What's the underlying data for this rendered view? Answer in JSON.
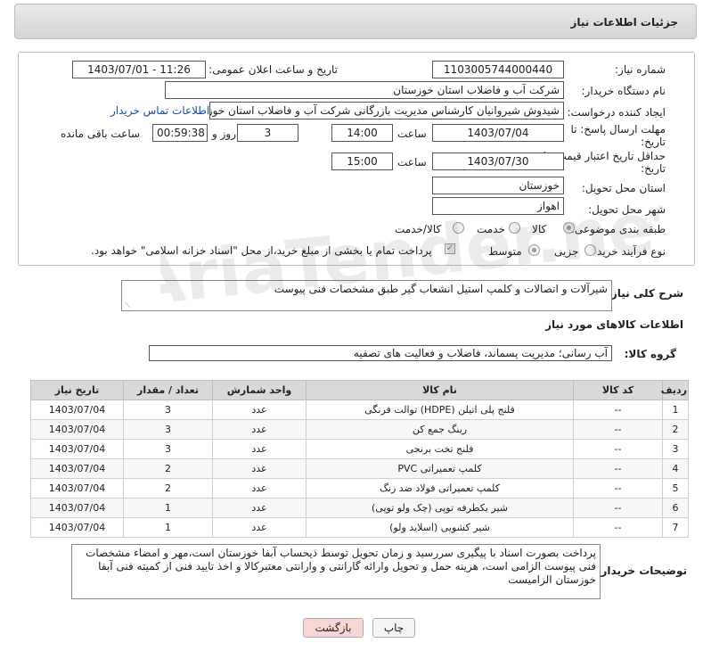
{
  "page": {
    "title": "جزئیات اطلاعات نیاز"
  },
  "form": {
    "need_number_label": "شماره نیاز:",
    "need_number": "1103005744000440",
    "announce_label": "تاریخ و ساعت اعلان عمومی:",
    "announce_value": "1403/07/01 - 11:26",
    "buyer_label": "نام دستگاه خریدار:",
    "buyer_value": "شرکت آب و فاضلاب استان خوزستان",
    "creator_label": "ایجاد کننده درخواست:",
    "creator_value": "شیدوش شیروانیان کارشناس مدیریت بازرگانی شرکت آب و فاضلاب استان خوزس",
    "contact_link": "اطلاعات تماس خریدار",
    "deadline_label": "مهلت ارسال پاسخ: تا",
    "deadline_label2": "تاریخ:",
    "deadline_date": "1403/07/04",
    "time_label": "ساعت",
    "deadline_time": "14:00",
    "days_value": "3",
    "days_label": "روز و",
    "remaining_value": "00:59:38",
    "remaining_label": "ساعت باقی مانده",
    "validity_label": "حداقل تاریخ اعتبار قیمت: تا",
    "validity_label2": "تاریخ:",
    "validity_date": "1403/07/30",
    "validity_time": "15:00",
    "province_label": "استان محل تحویل:",
    "province_value": "خوزستان",
    "city_label": "شهر محل تحویل:",
    "city_value": "اهواز",
    "category_label": "طبقه بندی موضوعی:",
    "category_options": [
      "کالا",
      "خدمت",
      "کالا/خدمت"
    ],
    "process_label": "نوع فرآیند خرید :",
    "process_options": [
      "جزیی",
      "متوسط"
    ],
    "payment_note": "پرداخت تمام یا بخشی از مبلغ خرید،از محل \"اسناد خزانه اسلامی\" خواهد بود."
  },
  "description": {
    "label": "شرح کلی نیاز:",
    "value": "شیرآلات و اتصالات و کلمپ استیل انشعاب گیر  طبق مشخصات فنی پیوست"
  },
  "goods": {
    "section_title": "اطلاعات کالاهای مورد نیاز",
    "group_label": "گروه کالا:",
    "group_value": "آب رسانی؛ مدیریت پسماند، فاضلاب و فعالیت های تصفیه",
    "columns": [
      "ردیف",
      "کد کالا",
      "نام کالا",
      "واحد شمارش",
      "تعداد / مقدار",
      "تاریخ نیاز"
    ],
    "rows": [
      [
        "1",
        "--",
        "فلنج پلی اتیلن (HDPE) توالت فرنگی",
        "عدد",
        "3",
        "1403/07/04"
      ],
      [
        "2",
        "--",
        "رینگ جمع کن",
        "عدد",
        "3",
        "1403/07/04"
      ],
      [
        "3",
        "--",
        "فلنج تخت برنجی",
        "عدد",
        "3",
        "1403/07/04"
      ],
      [
        "4",
        "--",
        "کلمپ تعمیراتی PVC",
        "عدد",
        "2",
        "1403/07/04"
      ],
      [
        "5",
        "--",
        "کلمپ تعمیراتی فولاد ضد زنگ",
        "عدد",
        "2",
        "1403/07/04"
      ],
      [
        "6",
        "--",
        "شیر یکطرفه توپی (چک ولو توپی)",
        "عدد",
        "1",
        "1403/07/04"
      ],
      [
        "7",
        "--",
        "شیر کشویی (اسلاید ولو)",
        "عدد",
        "1",
        "1403/07/04"
      ]
    ]
  },
  "buyer_notes": {
    "label": "توضیحات خریدار:",
    "value": "پرداخت بصورت اسناد با پیگیری  سررسید و زمان تحویل توسط ذیحساب آبفا خوزستان است،مهر و امضاء مشخصات فنی پیوست الزامی است، هزینه حمل و تحویل وارائه گارانتی و وارانتی معتبرکالا و اخذ تایید فنی از کمیته فنی آبفا خوزستان الزامیست"
  },
  "buttons": {
    "print": "چاپ",
    "back": "بازگشت"
  },
  "watermark": {
    "text": "AriaTender.net"
  },
  "colors": {
    "link": "#1a4fa0",
    "back_button_bg": "#f9d6d6",
    "header_bg": "#dcdcdc"
  }
}
